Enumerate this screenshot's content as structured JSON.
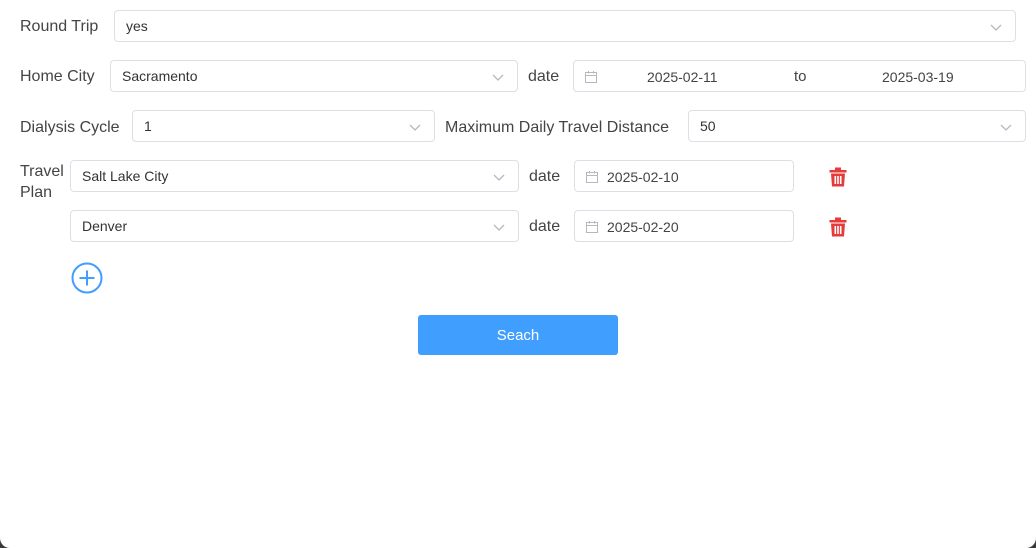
{
  "round_trip": {
    "label": "Round Trip",
    "value": "yes"
  },
  "home_city": {
    "label": "Home City",
    "value": "Sacramento"
  },
  "home_date": {
    "label": "date",
    "start": "2025-02-11",
    "separator": "to",
    "end": "2025-03-19"
  },
  "dialysis_cycle": {
    "label": "Dialysis Cycle",
    "value": "1"
  },
  "max_distance": {
    "label": "Maximum Daily Travel Distance",
    "value": "50"
  },
  "travel_plan": {
    "label_line1": "Travel",
    "label_line2": "Plan",
    "items": [
      {
        "city": "Salt Lake City",
        "date_label": "date",
        "date": "2025-02-10"
      },
      {
        "city": "Denver",
        "date_label": "date",
        "date": "2025-02-20"
      }
    ]
  },
  "search_button": {
    "label": "Seach"
  },
  "colors": {
    "primary": "#409eff",
    "danger": "#e63b3b",
    "border": "#dcdfe6"
  }
}
